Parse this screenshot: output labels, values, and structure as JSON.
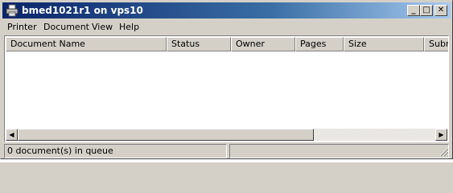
{
  "window": {
    "title": "bmed1021r1 on vps10",
    "icon": "printer-icon",
    "minimize_label": "_",
    "maximize_label": "□",
    "close_label": "✕"
  },
  "menu": {
    "items": [
      {
        "label": "Printer"
      },
      {
        "label": "Document"
      },
      {
        "label": "View"
      },
      {
        "label": "Help"
      }
    ]
  },
  "queue": {
    "columns": [
      {
        "label": "Document Name"
      },
      {
        "label": "Status"
      },
      {
        "label": "Owner"
      },
      {
        "label": "Pages"
      },
      {
        "label": "Size"
      },
      {
        "label": "Subm"
      }
    ],
    "rows": []
  },
  "scrollbar": {
    "left_arrow": "◀",
    "right_arrow": "▶"
  },
  "status": {
    "text": "0 document(s) in queue",
    "secondary": ""
  }
}
